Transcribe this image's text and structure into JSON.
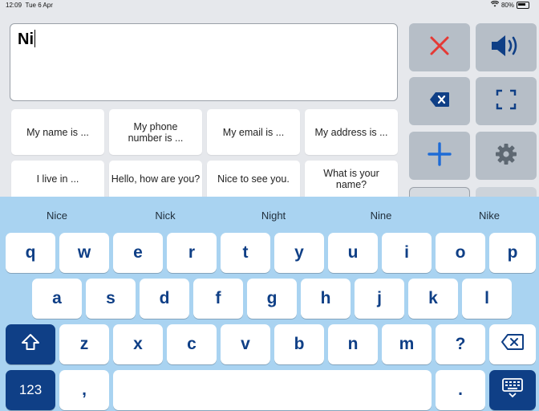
{
  "status": {
    "time": "12:09",
    "date": "Tue 6 Apr",
    "battery": "80%"
  },
  "editor": {
    "text": "Ni"
  },
  "phrases": [
    "My name is ...",
    "My phone number is ...",
    "My email is ...",
    "My address is ...",
    "I live in ...",
    "Hello, how are you?",
    "Nice to see you.",
    "What is your name?"
  ],
  "tools": {
    "clear_icon": "close-x-icon",
    "speak_icon": "speaker-icon",
    "backspace_icon": "backspace-icon",
    "fullscreen_icon": "fullscreen-icon",
    "add_icon": "plus-icon",
    "settings_icon": "gear-icon"
  },
  "keyboard": {
    "suggestions": [
      "Nice",
      "Nick",
      "Night",
      "Nine",
      "Nike"
    ],
    "row1": [
      "q",
      "w",
      "e",
      "r",
      "t",
      "y",
      "u",
      "i",
      "o",
      "p"
    ],
    "row2": [
      "a",
      "s",
      "d",
      "f",
      "g",
      "h",
      "j",
      "k",
      "l"
    ],
    "row3": [
      "z",
      "x",
      "c",
      "v",
      "b",
      "n",
      "m",
      "?"
    ],
    "numbers_label": "123",
    "comma_label": ",",
    "period_label": ".",
    "shift_icon": "shift-icon",
    "delete_icon": "delete-key-icon",
    "dismiss_icon": "keyboard-dismiss-icon"
  },
  "colors": {
    "accent": "#0f3f86",
    "keyboard_bg": "#a9d3f1",
    "clear_red": "#e53935",
    "add_blue": "#1e6bd6"
  }
}
